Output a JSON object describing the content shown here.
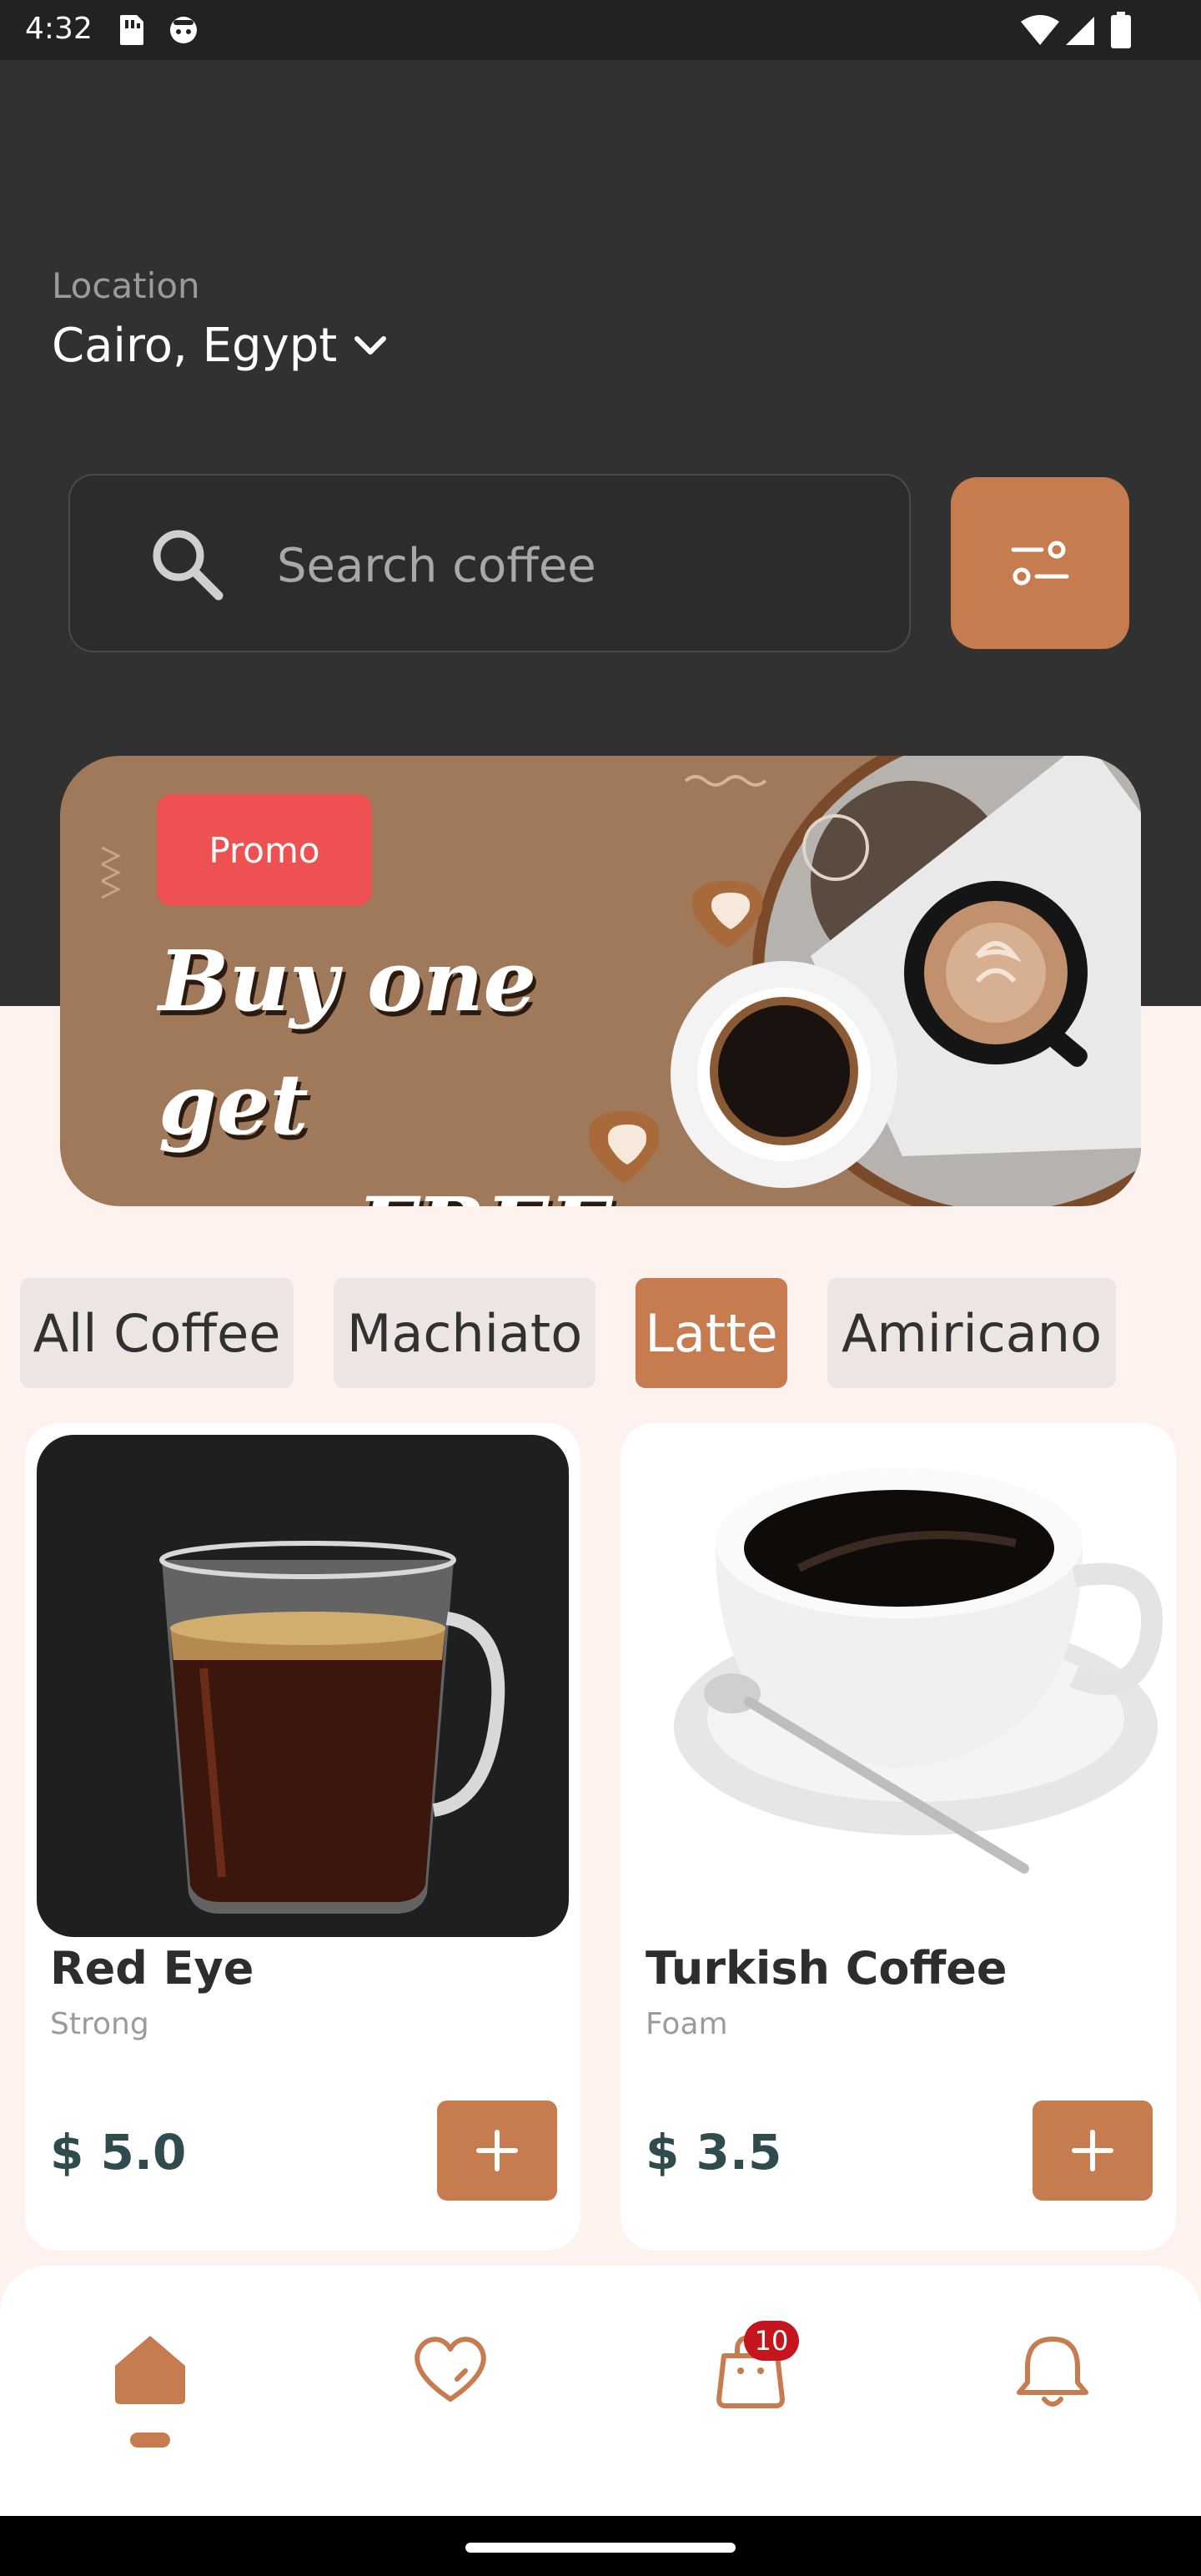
{
  "status_bar": {
    "time": "4:32"
  },
  "location": {
    "label": "Location",
    "value": "Cairo, Egypt"
  },
  "search": {
    "placeholder": "Search coffee"
  },
  "promo": {
    "badge": "Promo",
    "title_line1": "Buy one get",
    "title_line2": "one FREE"
  },
  "categories": [
    {
      "label": "All Coffee",
      "active": false
    },
    {
      "label": "Machiato",
      "active": false
    },
    {
      "label": "Latte",
      "active": true
    },
    {
      "label": "Amiricano",
      "active": false
    }
  ],
  "products": [
    {
      "name": "Red Eye",
      "subtitle": "Strong",
      "price": "$ 5.0"
    },
    {
      "name": "Turkish Coffee",
      "subtitle": "Foam",
      "price": "$ 3.5"
    }
  ],
  "nav": {
    "items": [
      "home-icon",
      "heart-icon",
      "bag-icon",
      "bell-icon"
    ],
    "cart_count": "10"
  },
  "colors": {
    "accent": "#C67C4E",
    "header": "#313131",
    "background": "#FDF2EE",
    "promo": "#A0795B",
    "badge": "#ED5151"
  }
}
